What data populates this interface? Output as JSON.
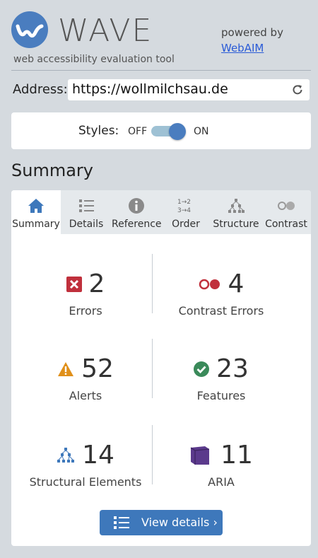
{
  "header": {
    "logo_text": "WAVE",
    "tagline": "web accessibility evaluation tool",
    "powered_by": "powered by",
    "webaim_link": "WebAIM"
  },
  "address": {
    "label": "Address:",
    "value": "https://wollmilchsau.de"
  },
  "styles": {
    "label": "Styles:",
    "off": "OFF",
    "on": "ON",
    "state": "on"
  },
  "summary_heading": "Summary",
  "tabs": [
    {
      "label": "Summary",
      "icon": "home-icon",
      "active": true
    },
    {
      "label": "Details",
      "icon": "list-icon",
      "active": false
    },
    {
      "label": "Reference",
      "icon": "info-icon",
      "active": false
    },
    {
      "label": "Order",
      "icon": "order-icon",
      "active": false
    },
    {
      "label": "Structure",
      "icon": "structure-icon",
      "active": false
    },
    {
      "label": "Contrast",
      "icon": "contrast-icon",
      "active": false
    }
  ],
  "stats": {
    "errors": {
      "count": "2",
      "label": "Errors",
      "icon": "error-icon",
      "color": "#c0303c"
    },
    "contrast_errors": {
      "count": "4",
      "label": "Contrast Errors",
      "icon": "contrast-error-icon",
      "color": "#c0303c"
    },
    "alerts": {
      "count": "52",
      "label": "Alerts",
      "icon": "alert-icon",
      "color": "#e0901a"
    },
    "features": {
      "count": "23",
      "label": "Features",
      "icon": "feature-icon",
      "color": "#3a8a5a"
    },
    "structural": {
      "count": "14",
      "label": "Structural Elements",
      "icon": "structure-icon",
      "color": "#3e78bb"
    },
    "aria": {
      "count": "11",
      "label": "ARIA",
      "icon": "aria-icon",
      "color": "#5b3a8c"
    }
  },
  "view_details": "View details ›",
  "colors": {
    "accent": "#4a7dbf",
    "background": "#d5dadf",
    "button": "#3e78bb"
  }
}
